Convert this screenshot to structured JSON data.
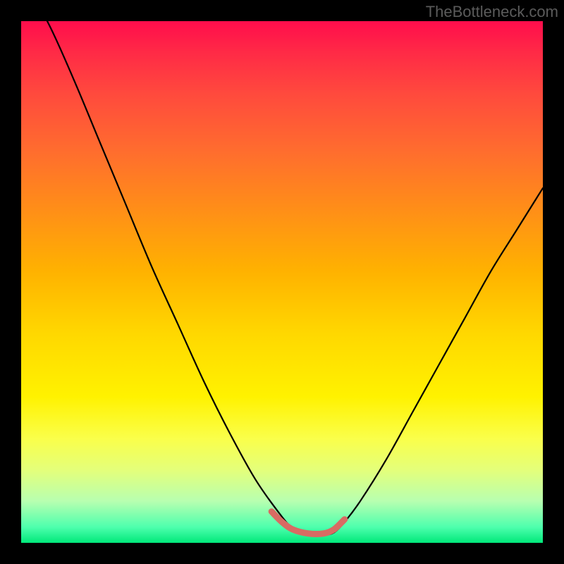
{
  "caption": "TheBottleneck.com",
  "colors": {
    "frame": "#000000",
    "curve_stroke": "#000000",
    "highlight_stroke": "#d86b63",
    "gradient_top": "#ff0d4c",
    "gradient_bottom": "#00e87a"
  },
  "chart_data": {
    "type": "line",
    "title": "",
    "xlabel": "",
    "ylabel": "",
    "xlim": [
      0,
      1
    ],
    "ylim": [
      0,
      1
    ],
    "series": [
      {
        "name": "curve",
        "x": [
          0.0,
          0.05,
          0.1,
          0.15,
          0.2,
          0.25,
          0.3,
          0.35,
          0.4,
          0.45,
          0.5,
          0.52,
          0.55,
          0.58,
          0.6,
          0.62,
          0.65,
          0.7,
          0.75,
          0.8,
          0.85,
          0.9,
          0.95,
          1.0
        ],
        "y": [
          1.08,
          1.0,
          0.89,
          0.77,
          0.65,
          0.53,
          0.42,
          0.31,
          0.21,
          0.12,
          0.05,
          0.03,
          0.015,
          0.015,
          0.02,
          0.04,
          0.08,
          0.16,
          0.25,
          0.34,
          0.43,
          0.52,
          0.6,
          0.68
        ]
      },
      {
        "name": "highlight",
        "x": [
          0.48,
          0.5,
          0.52,
          0.55,
          0.58,
          0.6,
          0.62
        ],
        "y": [
          0.06,
          0.04,
          0.026,
          0.018,
          0.018,
          0.026,
          0.045
        ]
      }
    ],
    "legend": [],
    "grid": false
  }
}
